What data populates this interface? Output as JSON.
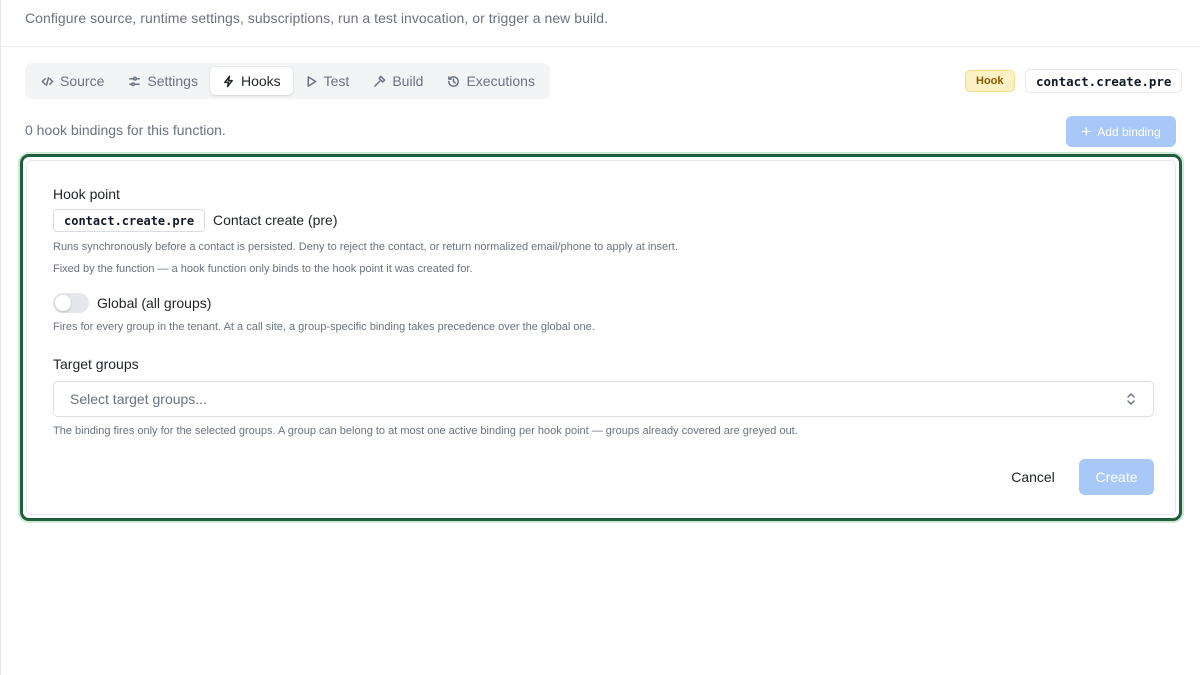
{
  "header": {
    "description": "Configure source, runtime settings, subscriptions, run a test invocation, or trigger a new build."
  },
  "tabs": [
    {
      "label": "Source",
      "icon": "code-icon"
    },
    {
      "label": "Settings",
      "icon": "sliders-icon"
    },
    {
      "label": "Hooks",
      "icon": "lightning-icon",
      "active": true
    },
    {
      "label": "Test",
      "icon": "play-icon"
    },
    {
      "label": "Build",
      "icon": "hammer-icon"
    },
    {
      "label": "Executions",
      "icon": "history-icon"
    }
  ],
  "function": {
    "kind_badge": "Hook",
    "name": "contact.create.pre"
  },
  "bindings": {
    "count_text": "0 hook bindings for this function.",
    "add_label": "Add binding"
  },
  "form": {
    "hook_point_label": "Hook point",
    "hook_point_code": "contact.create.pre",
    "hook_point_name": "Contact create (pre)",
    "hook_point_help1": "Runs synchronously before a contact is persisted. Deny to reject the contact, or return normalized email/phone to apply at insert.",
    "hook_point_help2": "Fixed by the function — a hook function only binds to the hook point it was created for.",
    "global_label": "Global (all groups)",
    "global_on": false,
    "global_help": "Fires for every group in the tenant. At a call site, a group-specific binding takes precedence over the global one.",
    "target_label": "Target groups",
    "target_placeholder": "Select target groups...",
    "target_help": "The binding fires only for the selected groups. A group can belong to at most one active binding per hook point — groups already covered are greyed out.",
    "cancel_label": "Cancel",
    "create_label": "Create"
  },
  "colors": {
    "accent_disabled": "#a8c8f8",
    "focus_border": "#1f5d3c",
    "hook_badge_bg": "#fdf0c4"
  }
}
